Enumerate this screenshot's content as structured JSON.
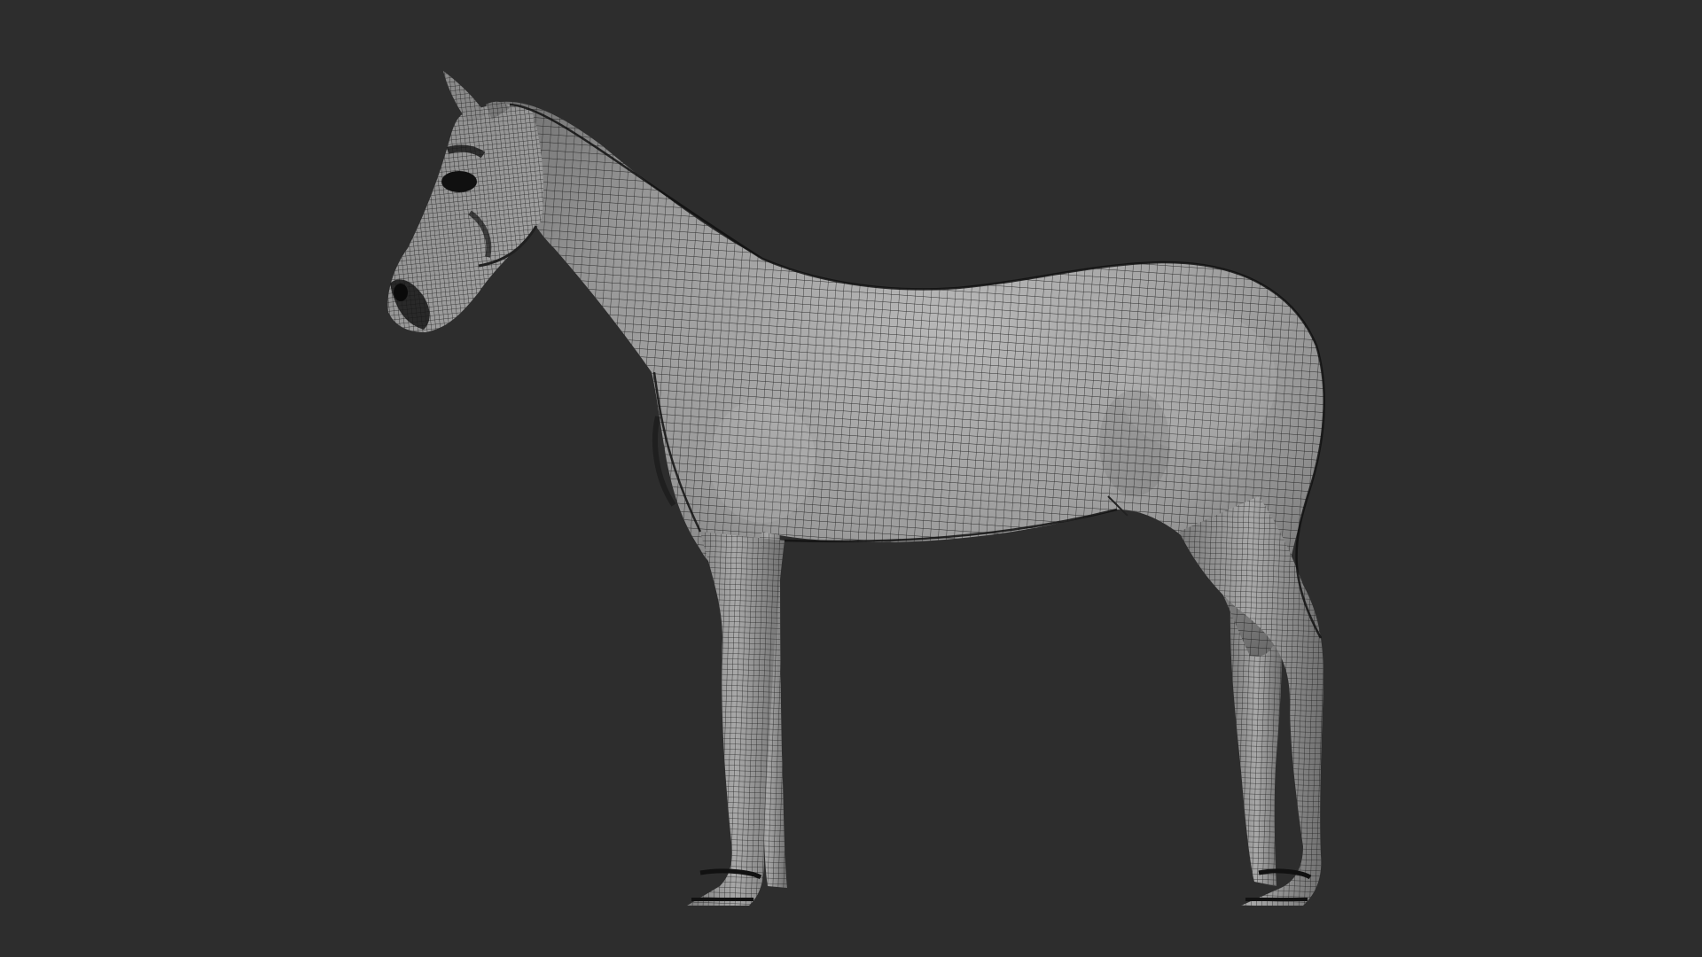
{
  "scene": {
    "subject": "horse-wireframe-mesh",
    "background_color": "#2d2d2d",
    "mesh_fill_color": "#8e8e8e",
    "mesh_line_color": "#1b1b1b",
    "dark_detail_color": "#121212",
    "light_color": "#b8b8b8"
  }
}
